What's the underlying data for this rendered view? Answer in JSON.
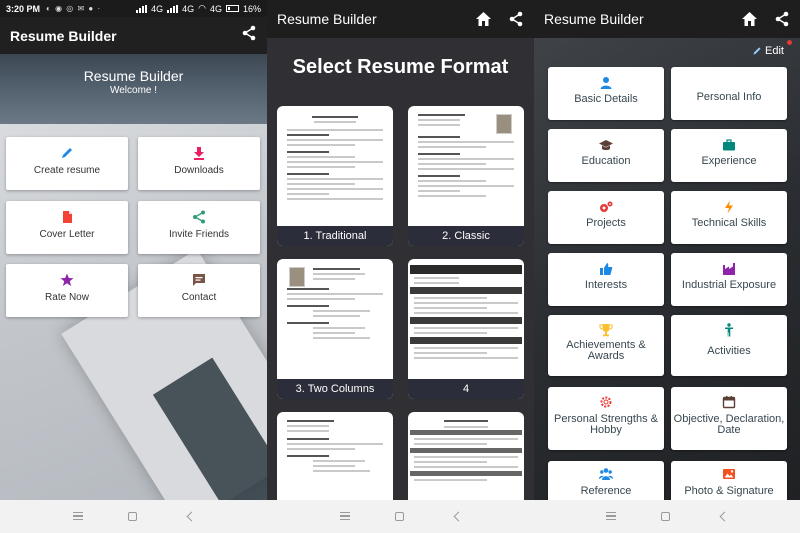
{
  "status_bar": {
    "time": "3:20 PM",
    "network": "4G",
    "battery": "16%"
  },
  "app_title": "Resume Builder",
  "home": {
    "hero_title": "Resume Builder",
    "hero_subtitle": "Welcome !",
    "menu": [
      {
        "label": "Create resume",
        "icon": "pencil-icon",
        "color": "#1e88e5"
      },
      {
        "label": "Downloads",
        "icon": "download-icon",
        "color": "#e91e63"
      },
      {
        "label": "Cover Letter",
        "icon": "document-icon",
        "color": "#f44336"
      },
      {
        "label": "Invite Friends",
        "icon": "share-icon",
        "color": "#2e9d7c"
      },
      {
        "label": "Rate Now",
        "icon": "star-icon",
        "color": "#8e24aa"
      },
      {
        "label": "Contact",
        "icon": "chat-icon",
        "color": "#795548"
      }
    ]
  },
  "formats": {
    "title": "Select Resume Format",
    "items": [
      {
        "label": "1. Traditional"
      },
      {
        "label": "2. Classic"
      },
      {
        "label": "3. Two Columns"
      },
      {
        "label": "4"
      },
      {
        "label": ""
      },
      {
        "label": ""
      }
    ]
  },
  "sections": {
    "edit_label": "Edit",
    "items": [
      {
        "label": "Basic Details",
        "icon": "person-icon",
        "color": "#1e88e5"
      },
      {
        "label": "Personal Info",
        "icon": "",
        "color": ""
      },
      {
        "label": "Education",
        "icon": "graduation-cap-icon",
        "color": "#5d4037"
      },
      {
        "label": "Experience",
        "icon": "briefcase-icon",
        "color": "#00897b"
      },
      {
        "label": "Projects",
        "icon": "gears-icon",
        "color": "#e53935"
      },
      {
        "label": "Technical Skills",
        "icon": "lightning-icon",
        "color": "#fb8c00"
      },
      {
        "label": "Interests",
        "icon": "thumbs-up-icon",
        "color": "#1e88e5"
      },
      {
        "label": "Industrial Exposure",
        "icon": "factory-icon",
        "color": "#8e24aa"
      },
      {
        "label": "Achievements & Awards",
        "icon": "trophy-icon",
        "color": "#fbc02d"
      },
      {
        "label": "Activities",
        "icon": "figure-icon",
        "color": "#00897b"
      },
      {
        "label": "Personal Strengths & Hobby",
        "icon": "sun-icon",
        "color": "#e53935"
      },
      {
        "label": "Objective, Declaration, Date",
        "icon": "calendar-icon",
        "color": "#5d4037"
      },
      {
        "label": "Reference",
        "icon": "group-icon",
        "color": "#1e88e5"
      },
      {
        "label": "Photo & Signature",
        "icon": "picture-icon",
        "color": "#f4511e"
      }
    ]
  }
}
